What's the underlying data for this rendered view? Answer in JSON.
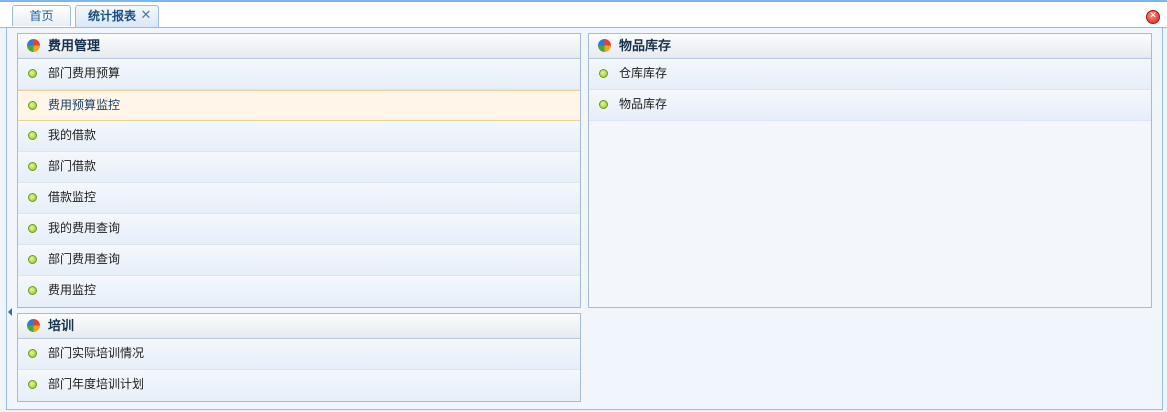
{
  "tabs": [
    {
      "label": "首页",
      "active": false
    },
    {
      "label": "统计报表",
      "active": true,
      "closable": true
    }
  ],
  "tab_close_glyph": "✕",
  "window_close_glyph": "✕",
  "panels": {
    "expense": {
      "title": "费用管理",
      "items": [
        "部门费用预算",
        "费用预算监控",
        "我的借款",
        "部门借款",
        "借款监控",
        "我的费用查询",
        "部门费用查询",
        "费用监控"
      ],
      "highlighted_item": "费用预算监控"
    },
    "inventory": {
      "title": "物品库存",
      "items": [
        "仓库库存",
        "物品库存"
      ]
    },
    "training": {
      "title": "培训",
      "items": [
        "部门实际培训情况",
        "部门年度培训计划"
      ]
    }
  },
  "icons": {
    "panel_icon": "pie-chart-icon",
    "item_icon": "green-dot-icon",
    "tab_close_icon": "close-icon",
    "window_close_icon": "close-circle-icon",
    "collapse_icon": "triangle-left-icon"
  },
  "colors": {
    "tab_border": "#99bbe8",
    "highlight_row": "#fff5e8",
    "bullet": "#8cc21b",
    "close_red": "#d9261a"
  }
}
